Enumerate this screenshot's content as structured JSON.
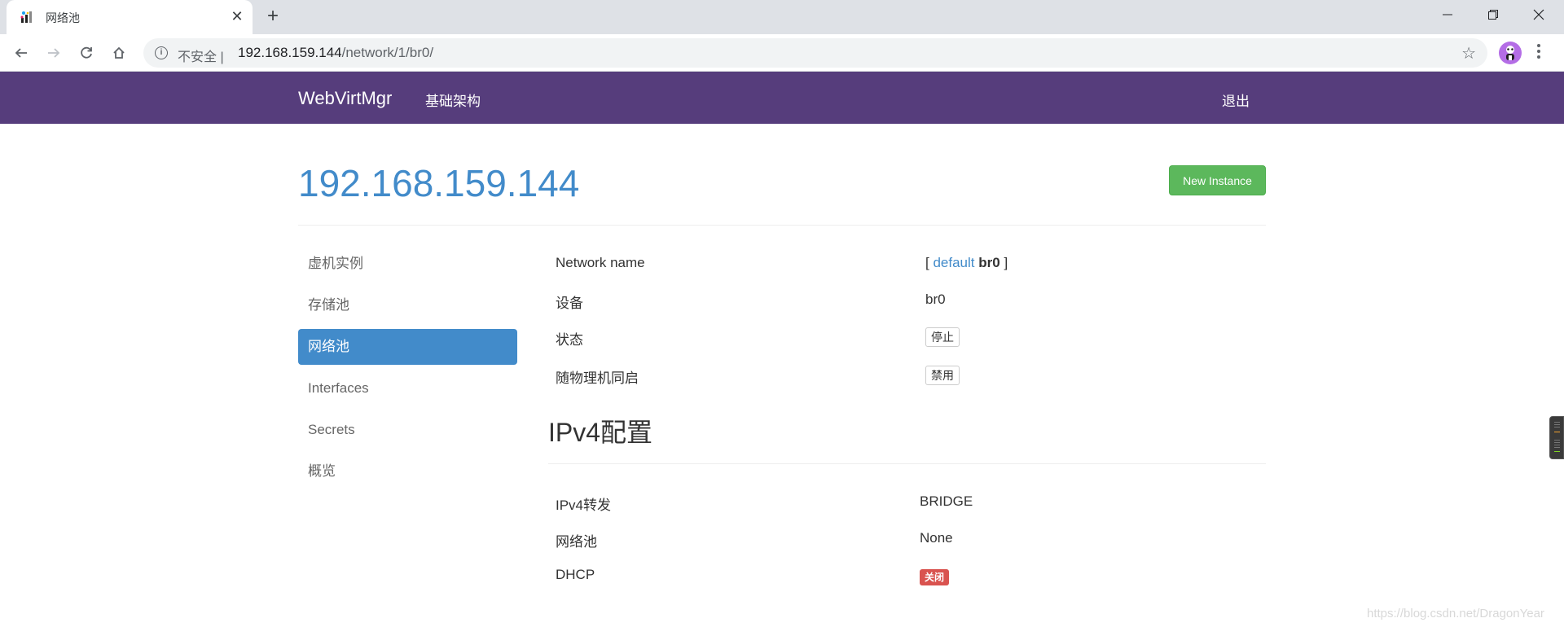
{
  "browser": {
    "tab_title": "网络池",
    "tab_icon": "webvirtmgr-favicon",
    "new_tab_label": "+",
    "security_label": "不安全",
    "url_host": "192.168.159.144",
    "url_path": "/network/1/br0/"
  },
  "navbar": {
    "brand": "WebVirtMgr",
    "links": [
      {
        "label": "基础架构"
      }
    ],
    "logout": "退出",
    "color": "#563d7c"
  },
  "header": {
    "title": "192.168.159.144",
    "new_instance_label": "New Instance"
  },
  "sidebar": {
    "items": [
      {
        "label": "虚机实例",
        "active": false
      },
      {
        "label": "存储池",
        "active": false
      },
      {
        "label": "网络池",
        "active": true
      },
      {
        "label": "Interfaces",
        "active": false
      },
      {
        "label": "Secrets",
        "active": false
      },
      {
        "label": "概览",
        "active": false
      }
    ]
  },
  "network": {
    "rows": [
      {
        "label": "Network name",
        "open_bracket": "[",
        "link": "default",
        "name": "br0",
        "close_bracket": "]"
      },
      {
        "label": "设备",
        "value": "br0"
      },
      {
        "label": "状态",
        "button": "停止"
      },
      {
        "label": "随物理机同启",
        "button": "禁用"
      }
    ]
  },
  "ipv4": {
    "title": "IPv4配置",
    "rows": [
      {
        "label": "IPv4转发",
        "value": "BRIDGE"
      },
      {
        "label": "网络池",
        "value": "None"
      },
      {
        "label": "DHCP",
        "badge": "关闭",
        "badge_color": "#d9534f"
      }
    ]
  },
  "watermark": "https://blog.csdn.net/DragonYear"
}
